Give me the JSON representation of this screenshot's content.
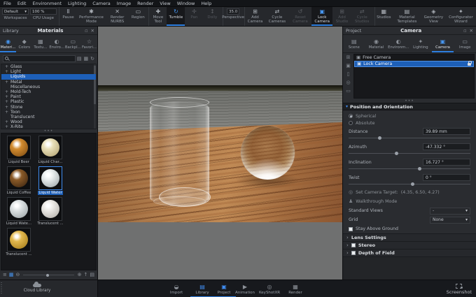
{
  "colors": {
    "accent": "#2e7fe0",
    "selection": "#1d5fb8",
    "panel": "#2a2c30",
    "viewport_grey": "#6f7070"
  },
  "menu": {
    "items": [
      "File",
      "Edit",
      "Environment",
      "Lighting",
      "Camera",
      "Image",
      "Render",
      "View",
      "Window",
      "Help"
    ]
  },
  "toolbar": {
    "workspaces": {
      "value": "Default",
      "label": "Workspaces"
    },
    "cpu": {
      "value": "100 %",
      "label": "CPU Usage"
    },
    "tools": [
      {
        "label": "Pause",
        "icon": "Ⅱ",
        "name": "pause",
        "sep": true
      },
      {
        "label": "Performance Mode",
        "icon": "✱",
        "name": "performance-mode"
      },
      {
        "label": "Render NURBS",
        "icon": "✕",
        "name": "render-nurbs"
      },
      {
        "label": "Region",
        "icon": "▭",
        "name": "region"
      },
      {
        "label": "Move Tool",
        "icon": "✚",
        "name": "move-tool",
        "sep": true
      },
      {
        "label": "Tumble",
        "icon": "↻",
        "name": "tumble",
        "active": true
      },
      {
        "label": "Pan",
        "icon": "✛",
        "name": "pan",
        "disabled": true
      },
      {
        "label": "Dolly",
        "icon": "↕",
        "name": "dolly",
        "disabled": true
      },
      {
        "label": "Perspective",
        "value": "35.0",
        "name": "perspective",
        "sep": true
      },
      {
        "label": "Add Camera",
        "icon": "⊞",
        "name": "add-camera",
        "sep": true
      },
      {
        "label": "Cycle Cameras",
        "icon": "⇄",
        "name": "cycle-cameras"
      },
      {
        "label": "Reset Camera",
        "icon": "↺",
        "name": "reset-camera",
        "disabled": true
      },
      {
        "label": "Lock Camera",
        "icon": "▣",
        "name": "lock-camera",
        "active": true
      },
      {
        "label": "Add Studio",
        "icon": "⊞",
        "name": "add-studio",
        "disabled": true
      },
      {
        "label": "Cycle Studios",
        "icon": "⇄",
        "name": "cycle-studios",
        "disabled": true
      },
      {
        "label": "Studios",
        "icon": "▦",
        "name": "studios",
        "sep": true
      },
      {
        "label": "Material Templates",
        "icon": "▤",
        "name": "material-templates"
      },
      {
        "label": "Geometry View",
        "icon": "◈",
        "name": "geometry-view"
      },
      {
        "label": "Configurator Wizard",
        "icon": "✦",
        "name": "configurator-wizard"
      }
    ]
  },
  "library": {
    "title": "Library",
    "header": "Materials",
    "window_icons": {
      "float": "▫",
      "close": "✕"
    },
    "tabs": [
      {
        "label": "Materi...",
        "icon": "◉",
        "name": "materials",
        "active": true
      },
      {
        "label": "Colors",
        "icon": "◆",
        "name": "colors"
      },
      {
        "label": "Textu...",
        "icon": "▦",
        "name": "textures"
      },
      {
        "label": "Enviro...",
        "icon": "◐",
        "name": "environments"
      },
      {
        "label": "Backpl...",
        "icon": "▭",
        "name": "backplates"
      },
      {
        "label": "Favori...",
        "icon": "☆",
        "name": "favorites"
      }
    ],
    "search": {
      "placeholder": ""
    },
    "search_icons": [
      {
        "name": "add-library-folder-icon",
        "glyph": "▤"
      },
      {
        "name": "import-folder-icon",
        "glyph": "▦"
      },
      {
        "name": "refresh-icon",
        "glyph": "↻"
      }
    ],
    "categories": [
      {
        "label": "Glass",
        "expand": "+"
      },
      {
        "label": "Light",
        "expand": "+"
      },
      {
        "label": "Liquids",
        "expand": "",
        "selected": true
      },
      {
        "label": "Metal",
        "expand": "+"
      },
      {
        "label": "Miscellaneous",
        "expand": ""
      },
      {
        "label": "Mold-Tech",
        "expand": "+"
      },
      {
        "label": "Paint",
        "expand": "+"
      },
      {
        "label": "Plastic",
        "expand": "+"
      },
      {
        "label": "Stone",
        "expand": "+"
      },
      {
        "label": "Toon",
        "expand": "+"
      },
      {
        "label": "Translucent",
        "expand": ""
      },
      {
        "label": "Wood",
        "expand": "+"
      },
      {
        "label": "X-Rite",
        "expand": "+"
      }
    ],
    "materials": [
      {
        "name": "Liquid Beer",
        "c1": "#d28b2f",
        "c2": "#7a4a12"
      },
      {
        "name": "Liquid Char...",
        "c1": "#e8dfb8",
        "c2": "#b0a070"
      },
      {
        "name": "Liquid Coffee",
        "c1": "#8a5a28",
        "c2": "#3a2410"
      },
      {
        "name": "Liquid Water",
        "c1": "#e8ecec",
        "c2": "#9aa4a6",
        "selected": true
      },
      {
        "name": "Liquid Wate...",
        "c1": "#dde2e3",
        "c2": "#98a0a2"
      },
      {
        "name": "Translucent ...",
        "c1": "#eceae6",
        "c2": "#b0aca6"
      },
      {
        "name": "Translucent ...",
        "c1": "#e2b84e",
        "c2": "#a07818"
      }
    ],
    "footer_icons": [
      {
        "name": "list-view-icon",
        "glyph": "≡"
      },
      {
        "name": "grid-view-icon",
        "glyph": "▦",
        "blue": true
      },
      {
        "name": "zoom-out-icon",
        "glyph": "⊖"
      },
      {
        "name": "zoom-in-icon",
        "glyph": "⊕"
      },
      {
        "name": "upload-icon",
        "glyph": "↑"
      },
      {
        "name": "folders-icon",
        "glyph": "▤"
      }
    ],
    "cloud_button": "Cloud Library"
  },
  "project": {
    "title": "Project",
    "header": "Camera",
    "window_icons": {
      "float": "▫",
      "close": "✕"
    },
    "tabs": [
      {
        "label": "Scene",
        "icon": "▤",
        "name": "scene"
      },
      {
        "label": "Material",
        "icon": "◉",
        "name": "material"
      },
      {
        "label": "Environm...",
        "icon": "◐",
        "name": "environment"
      },
      {
        "label": "Lighting",
        "icon": "✦",
        "name": "lighting"
      },
      {
        "label": "Camera",
        "icon": "▣",
        "name": "camera",
        "active": true
      },
      {
        "label": "Image",
        "icon": "▭",
        "name": "image"
      }
    ],
    "camera_strip_icons": [
      {
        "name": "add-camera-icon",
        "glyph": "⊞"
      },
      {
        "name": "duplicate-camera-icon",
        "glyph": "▣"
      },
      {
        "name": "delete-camera-icon",
        "glyph": "▯"
      },
      {
        "name": "camera-target-icon",
        "glyph": "◎"
      },
      {
        "name": "camera-views-icon",
        "glyph": "▭"
      }
    ],
    "cameras": [
      {
        "name": "Free Camera"
      },
      {
        "name": "Lock Camera",
        "selected": true,
        "locked": true
      }
    ],
    "position_section": "Position and Orientation",
    "radios": [
      {
        "label": "Spherical",
        "on": true
      },
      {
        "label": "Absolute",
        "on": false
      }
    ],
    "params": [
      {
        "label": "Distance",
        "value": "39.89 mm",
        "slider": 24
      },
      {
        "label": "Azimuth",
        "value": "-47.332 °",
        "slider": 38
      },
      {
        "label": "Inclination",
        "value": "16.727 °",
        "slider": 57
      },
      {
        "label": "Twist",
        "value": "0 °",
        "slider": 51
      }
    ],
    "target": {
      "label": "Set Camera Target:",
      "value": "(4.35, 6.50, 4.27)"
    },
    "walkthrough": "Walkthrough Mode",
    "standard_views": {
      "label": "Standard Views",
      "value": "-"
    },
    "grid": {
      "label": "Grid",
      "value": "None"
    },
    "stay_above_ground": "Stay Above Ground",
    "collapsed_sections": [
      {
        "label": "Lens Settings",
        "checkbox": false
      },
      {
        "label": "Stereo",
        "checkbox": true
      },
      {
        "label": "Depth of Field",
        "checkbox": true
      }
    ]
  },
  "bottom": {
    "items": [
      {
        "label": "Import",
        "icon": "◒",
        "name": "import"
      },
      {
        "label": "Library",
        "icon": "▤",
        "name": "library",
        "active": true
      },
      {
        "label": "Project",
        "icon": "▣",
        "name": "project",
        "active": true
      },
      {
        "label": "Animation",
        "icon": "▶",
        "name": "animation"
      },
      {
        "label": "KeyShotXR",
        "icon": "◎",
        "name": "keyshotxr"
      },
      {
        "label": "Render",
        "icon": "▦",
        "name": "render"
      }
    ],
    "screenshot": "Screenshot"
  }
}
